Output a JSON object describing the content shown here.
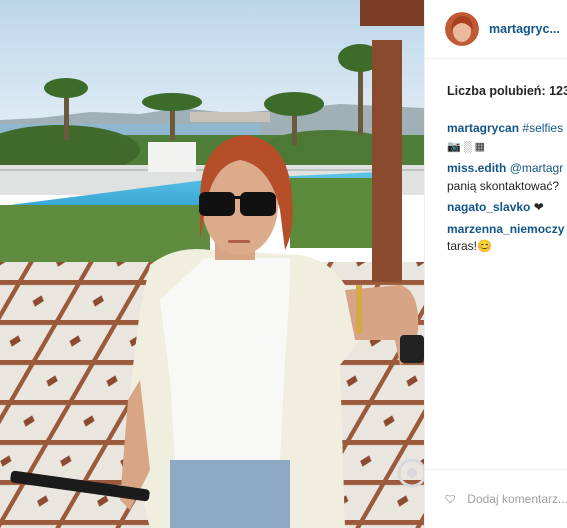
{
  "post": {
    "username": "martagryc...",
    "likes_label": "Liczba polubień: 123",
    "comments": [
      {
        "user": "martagrycan",
        "text": "#selfies",
        "icons": "📷 ░ ▦"
      },
      {
        "user": "miss.edith",
        "text": "@martagr",
        "text2": "panią skontaktować?"
      },
      {
        "user": "nagato_slavko",
        "text": "❤"
      },
      {
        "user": "marzenna_niemoczy",
        "text2": "taras!😊"
      }
    ],
    "add_comment_placeholder": "Dodaj komentarz..."
  },
  "colors": {
    "link": "#125688",
    "text": "#262626",
    "placeholder": "#a0a0a0",
    "divider": "#efefef"
  }
}
